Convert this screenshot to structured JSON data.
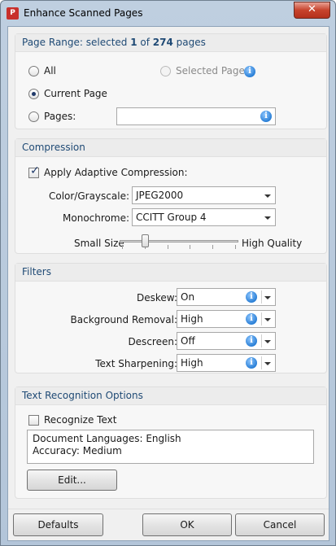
{
  "window": {
    "title": "Enhance Scanned Pages",
    "app_icon": "pdf-app-icon",
    "close_glyph": "✕"
  },
  "page_range": {
    "heading_prefix": "Page Range: selected ",
    "selected_count": "1",
    "heading_middle": " of ",
    "total_count": "274",
    "heading_suffix": " pages",
    "option_all": "All",
    "option_selected_pages": "Selected Pages",
    "option_current_page": "Current Page",
    "option_pages": "Pages:",
    "pages_input_value": "",
    "selected_option": "Current Page"
  },
  "compression": {
    "heading": "Compression",
    "adaptive_label": "Apply Adaptive Compression:",
    "adaptive_checked": true,
    "color_label": "Color/Grayscale:",
    "color_value": "JPEG2000",
    "mono_label": "Monochrome:",
    "mono_value": "CCITT Group 4",
    "slider_min_label": "Small Size",
    "slider_max_label": "High Quality",
    "slider_value_fraction": 0.2
  },
  "filters": {
    "heading": "Filters",
    "rows": [
      {
        "label": "Deskew:",
        "value": "On"
      },
      {
        "label": "Background Removal:",
        "value": "High"
      },
      {
        "label": "Descreen:",
        "value": "Off"
      },
      {
        "label": "Text Sharpening:",
        "value": "High"
      }
    ]
  },
  "text_recognition": {
    "heading": "Text Recognition Options",
    "recognize_label": "Recognize Text",
    "recognize_checked": false,
    "summary_line1": "Document Languages: English",
    "summary_line2": "Accuracy: Medium",
    "edit_button": "Edit..."
  },
  "footer": {
    "defaults_button": "Defaults",
    "ok_button": "OK",
    "cancel_button": "Cancel"
  },
  "colors": {
    "section_heading": "#1f4a75",
    "info_icon": "#2a7fd6",
    "title_bar": "#bfcfe0",
    "close_button": "#c7432c"
  },
  "icons": {
    "info": "info-icon",
    "dropdown": "chevron-down-icon",
    "check": "checkmark-icon"
  }
}
